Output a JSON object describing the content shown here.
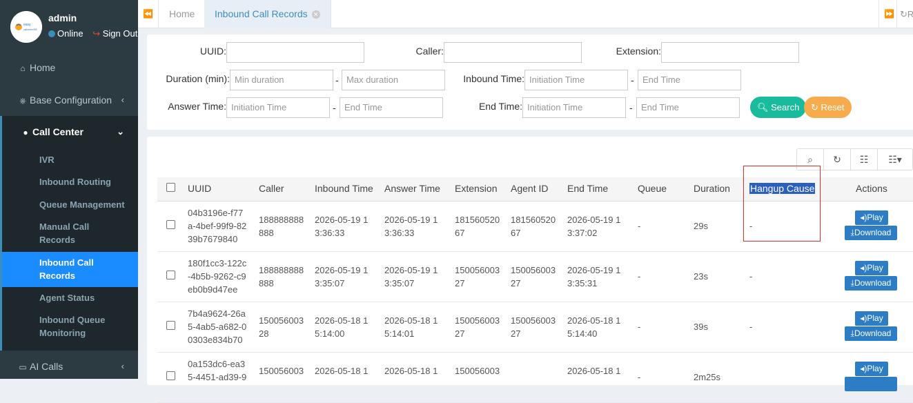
{
  "user": {
    "name": "admin",
    "status": "Online",
    "sign_out": "Sign Out",
    "logo_text_top": "easy",
    "logo_text_bottom": "callcenter365"
  },
  "nav": {
    "home": "Home",
    "base_config": "Base Configuration",
    "call_center": "Call Center",
    "ai_calls": "AI Calls",
    "sub": [
      "IVR",
      "Inbound Routing",
      "Queue Management",
      "Manual Call\nRecords",
      "Inbound Call\nRecords",
      "Agent Status",
      "Inbound Queue\nMonitoring"
    ]
  },
  "tabs": {
    "home": "Home",
    "active": "Inbound Call Records",
    "refresh_partial": "R"
  },
  "filters": {
    "uuid_label": "UUID:",
    "caller_label": "Caller:",
    "extension_label": "Extension:",
    "duration_label": "Duration (min):",
    "min_duration_ph": "Min duration",
    "max_duration_ph": "Max duration",
    "inbound_time_label": "Inbound Time:",
    "answer_time_label": "Answer Time:",
    "end_time_label": "End Time:",
    "initiation_time_ph": "Initiation Time",
    "end_time_ph": "End Time",
    "search_btn": "Search",
    "reset_btn": "Reset"
  },
  "table": {
    "headers": [
      "UUID",
      "Caller",
      "Inbound Time",
      "Answer Time",
      "Extension",
      "Agent ID",
      "End Time",
      "Queue",
      "Duration",
      "Hangup Cause",
      "Actions"
    ],
    "play_label": "Play",
    "download_label": "Download",
    "rows": [
      {
        "uuid": "04b3196e-f77\na-4bef-99f9-82\n39b7679840",
        "caller": "188888888\n888",
        "inbound": "2026-05-19 1\n3:36:33",
        "answer": "2026-05-19 1\n3:36:33",
        "ext": "181560520\n67",
        "agent": "181560520\n67",
        "end": "2026-05-19 1\n3:37:02",
        "queue": "-",
        "duration": "29s",
        "hangup": "-"
      },
      {
        "uuid": "180f1cc3-122c\n-4b5b-9262-c9\neb0b9d47ee",
        "caller": "188888888\n888",
        "inbound": "2026-05-19 1\n3:35:07",
        "answer": "2026-05-19 1\n3:35:07",
        "ext": "150056003\n27",
        "agent": "150056003\n27",
        "end": "2026-05-19 1\n3:35:31",
        "queue": "-",
        "duration": "23s",
        "hangup": "-"
      },
      {
        "uuid": "7b4a9624-26a\n5-4ab5-a682-0\n0303e834b70",
        "caller": "150056003\n28",
        "inbound": "2026-05-18 1\n5:14:00",
        "answer": "2026-05-18 1\n5:14:01",
        "ext": "150056003\n27",
        "agent": "150056003\n27",
        "end": "2026-05-18 1\n5:14:40",
        "queue": "-",
        "duration": "39s",
        "hangup": "-"
      },
      {
        "uuid": "0a153dc6-ea3\n5-4451-ad39-9",
        "caller": "150056003",
        "inbound": "2026-05-18 1",
        "answer": "2026-05-18 1",
        "ext": "150056003",
        "agent": "",
        "end": "2026-05-18 1",
        "queue": "-",
        "duration": "2m25s",
        "hangup": ""
      }
    ]
  }
}
